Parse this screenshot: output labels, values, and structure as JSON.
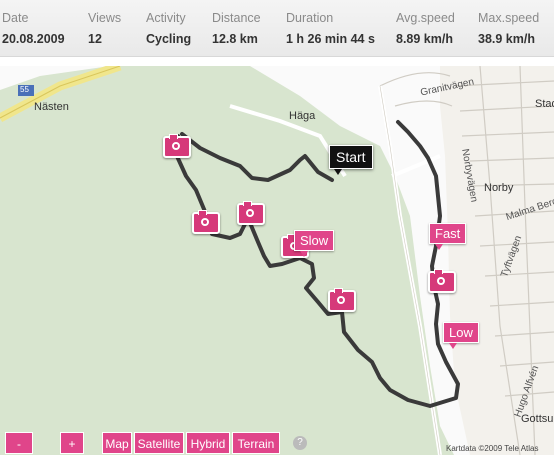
{
  "stats": [
    {
      "header": "Date",
      "value": "20.08.2009"
    },
    {
      "header": "Views",
      "value": "12"
    },
    {
      "header": "Activity",
      "value": "Cycling"
    },
    {
      "header": "Distance",
      "value": "12.8 km"
    },
    {
      "header": "Duration",
      "value": "1 h 26 min 44 s"
    },
    {
      "header": "Avg.speed",
      "value": "8.89 km/h"
    },
    {
      "header": "Max.speed",
      "value": "38.9 km/h"
    }
  ],
  "map": {
    "places": {
      "nasten": "Nästen",
      "haga": "Häga",
      "norby": "Norby",
      "gottsunda": "Gottsun",
      "stadion": "Stad"
    },
    "streets": {
      "granitvagen": "Granitvägen",
      "norbyvagen": "Norbyvägen",
      "malma_berg": "Malma Berg",
      "tyftvagen": "Tyftvägen",
      "hugo_alfven": "Hugo Alfvén",
      "road_number": "55"
    },
    "markers": {
      "start": "Start",
      "fast": "Fast",
      "slow": "Slow",
      "low": "Low"
    },
    "controls": {
      "zoom_out": "-",
      "zoom_in": "+",
      "map": "Map",
      "satellite": "Satellite",
      "hybrid": "Hybrid",
      "terrain": "Terrain",
      "help": "?"
    },
    "copyright": "Kartdata ©2009 Tele Atlas"
  },
  "colors": {
    "accent": "#e0458a",
    "forest": "#d7e4cf",
    "route": "#3a3a3a"
  }
}
